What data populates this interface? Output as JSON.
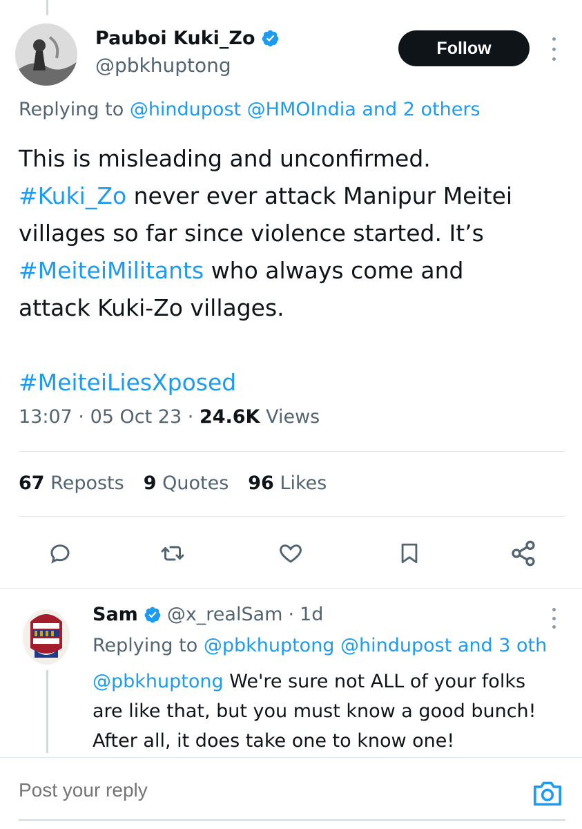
{
  "tweet": {
    "author": {
      "name": "Pauboi Kuki_Zo",
      "handle": "@pbkhuptong"
    },
    "follow_label": "Follow",
    "replying_prefix": "Replying to",
    "replying_to": "@hindupost @HMOIndia and 2 others",
    "text": {
      "line1": "This is misleading and unconfirmed.",
      "hashtag1": "#Kuki_Zo",
      "line2_rest": " never ever attack Manipur Meitei",
      "line3": "villages so far since violence started. It’s",
      "hashtag2": "#MeiteiMilitants",
      "line4_rest": " who always come and",
      "line5": "attack Kuki-Zo villages.",
      "hashtag3": "#MeiteiLiesXposed"
    },
    "time": "13:07",
    "date": "05 Oct 23",
    "views_count": "24.6K",
    "views_label": "Views",
    "separator": "·",
    "stats": {
      "reposts_count": "67",
      "reposts_label": "Reposts",
      "quotes_count": "9",
      "quotes_label": "Quotes",
      "likes_count": "96",
      "likes_label": "Likes"
    },
    "actions": [
      "reply-icon",
      "repost-icon",
      "like-icon",
      "bookmark-icon",
      "share-icon"
    ]
  },
  "reply": {
    "name": "Sam",
    "handle": "@x_realSam",
    "age": "1d",
    "replying_prefix": "Replying to",
    "replying_to": "@pbkhuptong @hindupost and 3 oth",
    "mention": "@pbkhuptong",
    "line1_rest": " We're sure not ALL of your folks",
    "line2": "are like that, but you must know a good bunch!",
    "line3": "After all, it does take one to know one!"
  },
  "composer": {
    "placeholder": "Post your reply"
  },
  "colors": {
    "accent": "#1d9bf0",
    "text": "#0f1419",
    "secondary": "#536471",
    "follow_bg": "#0f1419"
  }
}
